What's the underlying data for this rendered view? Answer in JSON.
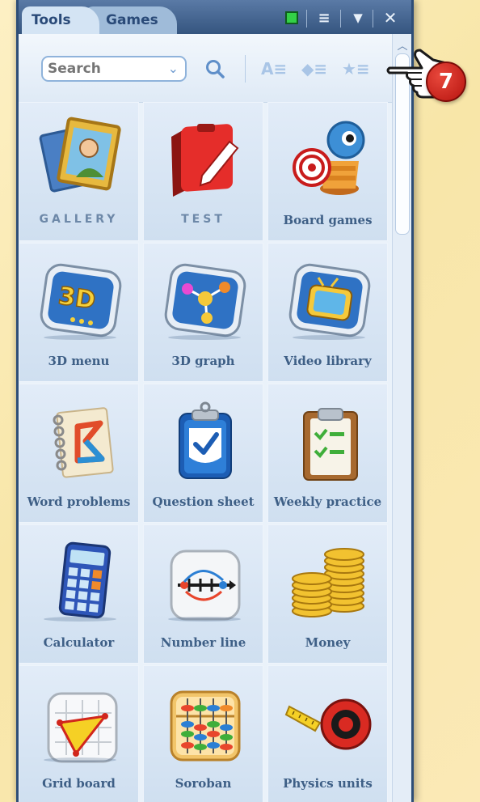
{
  "tabs": [
    {
      "label": "Tools",
      "active": true
    },
    {
      "label": "Games",
      "active": false
    }
  ],
  "window_controls": [
    "green-status-icon",
    "menu-icon",
    "collapse-icon",
    "close-icon"
  ],
  "window_symbols": {
    "menu": "≡",
    "collapse": "▼",
    "close": "✕"
  },
  "search": {
    "placeholder": "Search",
    "dropdown_glyph": "⌄"
  },
  "toolbar_icons": [
    {
      "name": "search-icon",
      "glyph": "⌕"
    },
    {
      "name": "sort-alpha-icon",
      "glyph": "A≡"
    },
    {
      "name": "toggle-view-icon",
      "glyph": "◆≡"
    },
    {
      "name": "favorites-icon",
      "glyph": "★≡"
    }
  ],
  "scroll": {
    "up_glyph": "︿"
  },
  "callout": {
    "number": "7"
  },
  "tools": [
    {
      "label": "GALLERY",
      "icon": "picture-frame-icon"
    },
    {
      "label": "TEST",
      "icon": "test-notebook-icon"
    },
    {
      "label": "Board games",
      "icon": "board-games-icon"
    },
    {
      "label": "3D menu",
      "icon": "3d-menu-icon"
    },
    {
      "label": "3D graph",
      "icon": "3d-graph-icon"
    },
    {
      "label": "Video library",
      "icon": "video-tv-icon"
    },
    {
      "label": "Word problems",
      "icon": "word-problems-notebook-icon"
    },
    {
      "label": "Question sheet",
      "icon": "question-sheet-icon"
    },
    {
      "label": "Weekly practice",
      "icon": "weekly-practice-clipboard-icon"
    },
    {
      "label": "Calculator",
      "icon": "calculator-icon"
    },
    {
      "label": "Number line",
      "icon": "number-line-icon"
    },
    {
      "label": "Money",
      "icon": "coins-icon"
    },
    {
      "label": "Grid board",
      "icon": "grid-board-icon"
    },
    {
      "label": "Soroban",
      "icon": "soroban-abacus-icon"
    },
    {
      "label": "Physics units",
      "icon": "tape-measure-icon"
    }
  ]
}
